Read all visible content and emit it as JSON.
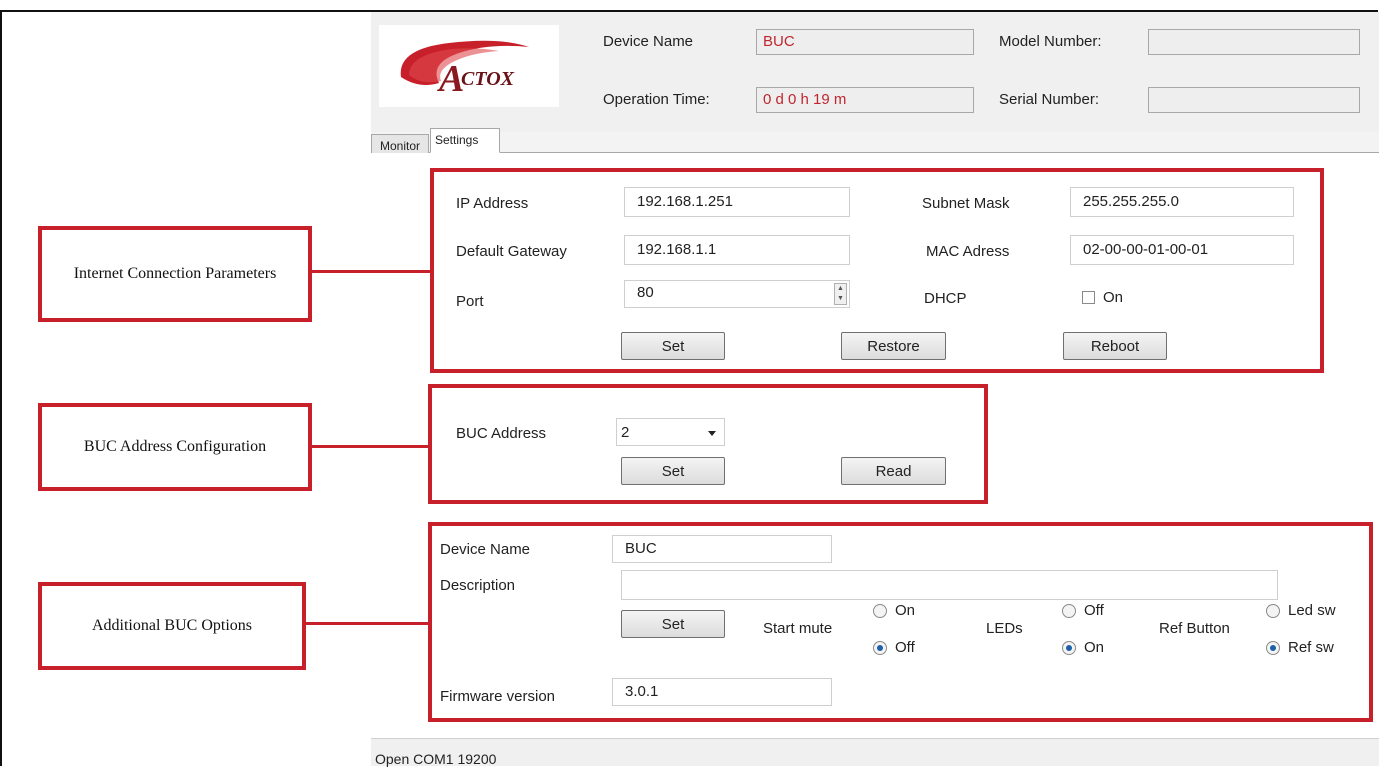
{
  "header": {
    "device_name_label": "Device Name",
    "device_name_value": "BUC",
    "model_number_label": "Model Number:",
    "model_number_value": "",
    "operation_time_label": "Operation Time:",
    "operation_time_value": "0 d 0 h 19 m",
    "serial_number_label": "Serial Number:",
    "serial_number_value": "",
    "logo_text": "ACTOX"
  },
  "tabs": [
    {
      "label": "Monitor",
      "active": false
    },
    {
      "label": "Settings",
      "active": true
    }
  ],
  "callouts": {
    "internet": "Internet Connection Parameters",
    "buc_address": "BUC Address Configuration",
    "additional": "Additional BUC Options"
  },
  "network": {
    "ip_label": "IP Address",
    "ip_value": "192.168.1.251",
    "subnet_label": "Subnet Mask",
    "subnet_value": "255.255.255.0",
    "gateway_label": "Default Gateway",
    "gateway_value": "192.168.1.1",
    "mac_label": "MAC Adress",
    "mac_value": "02-00-00-01-00-01",
    "port_label": "Port",
    "port_value": "80",
    "dhcp_label": "DHCP",
    "dhcp_on_label": "On",
    "dhcp_checked": false,
    "set_button": "Set",
    "restore_button": "Restore",
    "reboot_button": "Reboot"
  },
  "address": {
    "label": "BUC Address",
    "value": "2",
    "set_button": "Set",
    "read_button": "Read"
  },
  "options": {
    "device_name_label": "Device Name",
    "device_name_value": "BUC",
    "description_label": "Description",
    "description_value": "",
    "set_button": "Set",
    "start_mute_label": "Start mute",
    "start_mute_on": "On",
    "start_mute_off": "Off",
    "start_mute_selected": "Off",
    "leds_label": "LEDs",
    "leds_off": "Off",
    "leds_on": "On",
    "leds_selected": "On",
    "ref_button_label": "Ref Button",
    "ref_led_sw": "Led sw",
    "ref_ref_sw": "Ref sw",
    "ref_selected": "Ref sw",
    "firmware_label": "Firmware version",
    "firmware_value": "3.0.1"
  },
  "status_bar": {
    "text": "Open COM1  19200"
  },
  "colors": {
    "annotation_red": "#c8202a",
    "value_red": "#c0262f",
    "radio_selected": "#1d5fa8"
  }
}
